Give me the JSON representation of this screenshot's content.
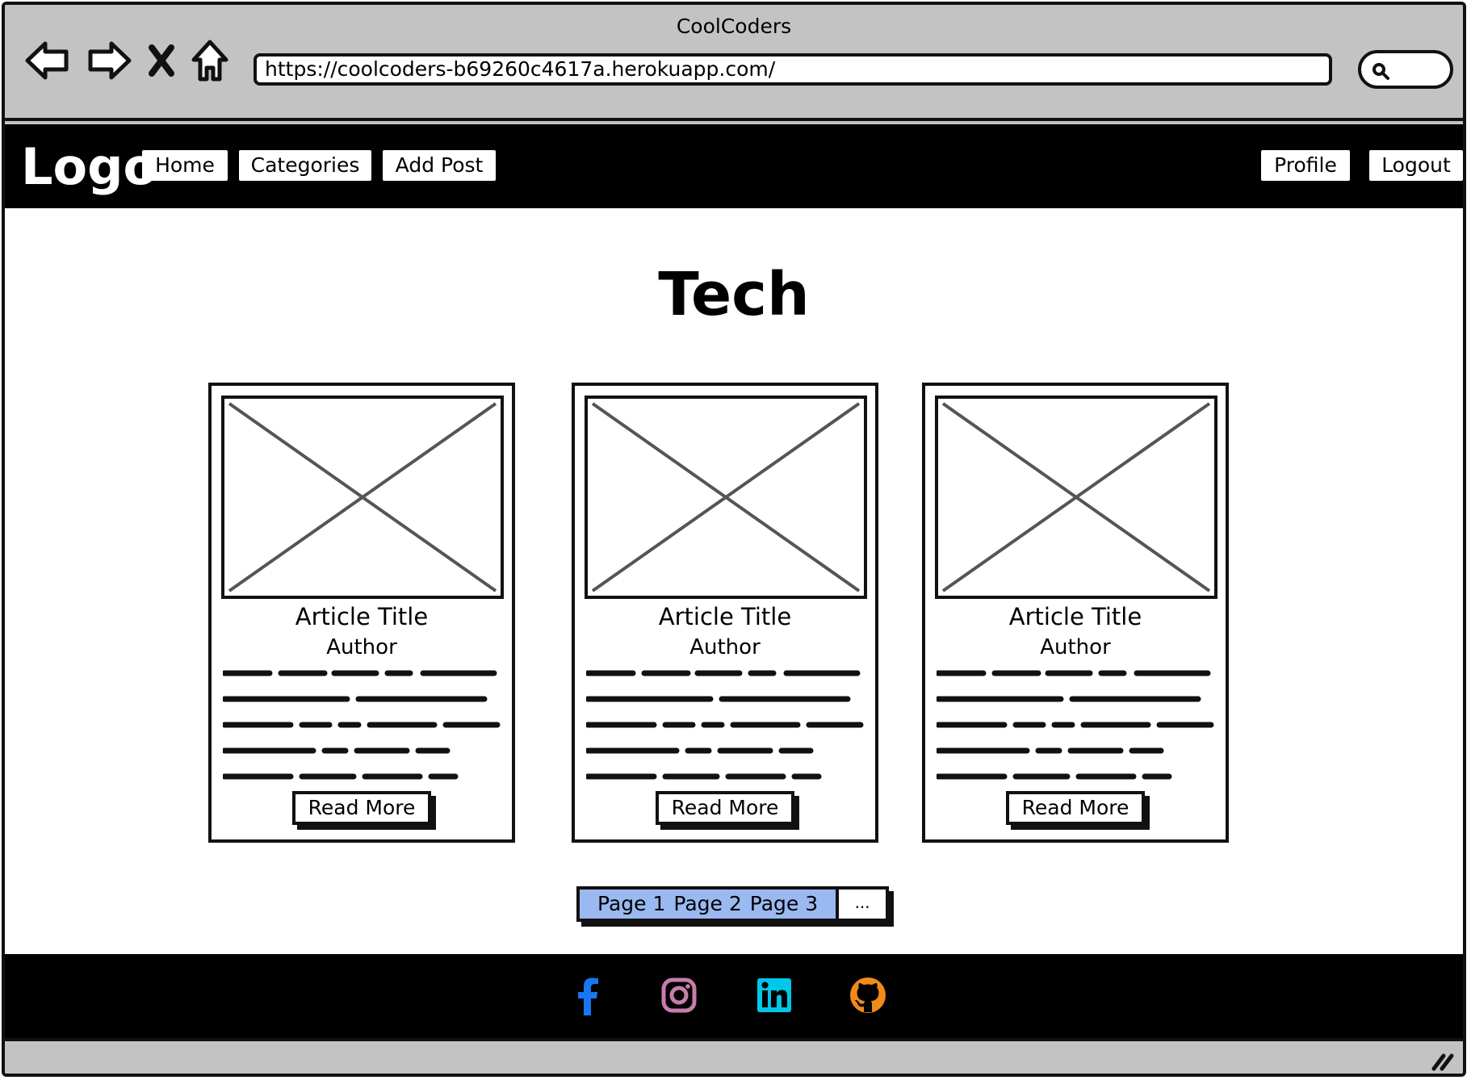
{
  "window": {
    "title": "CoolCoders"
  },
  "browser": {
    "url": "https://coolcoders-b69260c4617a.herokuapp.com/",
    "icons": [
      "back-arrow-icon",
      "forward-arrow-icon",
      "close-x-icon",
      "home-icon",
      "search-icon"
    ]
  },
  "navbar": {
    "logo": "Logo",
    "home": "Home",
    "categories": "Categories",
    "add_post": "Add Post",
    "profile": "Profile",
    "logout": "Logout"
  },
  "page": {
    "title": "Tech"
  },
  "cards": [
    {
      "title": "Article Title",
      "author": "Author",
      "button": "Read More"
    },
    {
      "title": "Article Title",
      "author": "Author",
      "button": "Read More"
    },
    {
      "title": "Article Title",
      "author": "Author",
      "button": "Read More"
    }
  ],
  "pagination": {
    "page1": "Page 1",
    "page2": "Page 2",
    "page3": "Page 3",
    "more": "..."
  },
  "footer": {
    "icons": [
      "facebook-icon",
      "instagram-icon",
      "linkedin-icon",
      "github-icon"
    ],
    "colors": {
      "facebook": "#1877f2",
      "instagram": "#c77dac",
      "linkedin": "#00c8e6",
      "github": "#f08a1a",
      "pagination_active": "#9ab9f0"
    }
  }
}
